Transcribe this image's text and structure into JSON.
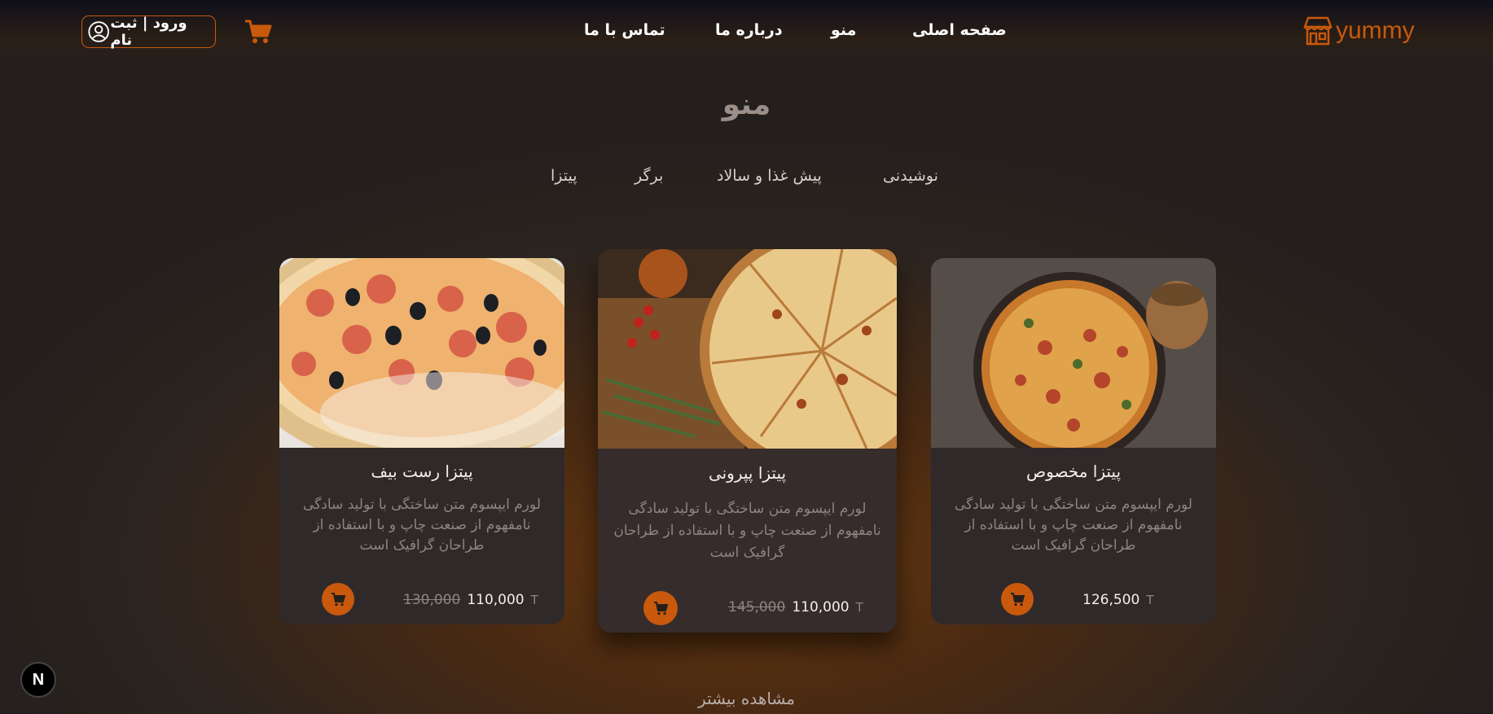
{
  "brand": {
    "name": "yummy",
    "accent": "#c9590c"
  },
  "nav": {
    "home": "صفحه اصلی",
    "menu": "منو",
    "about": "درباره ما",
    "contact": "تماس با ما"
  },
  "auth": {
    "label": "ورود | ثبت نام"
  },
  "section": {
    "title": "منو",
    "tabs": [
      "نوشیدنی",
      "پیش غذا و سالاد",
      "برگر",
      "پیتزا"
    ],
    "more": "مشاهده بیشتر"
  },
  "products": [
    {
      "name": "پیتزا مخصوص",
      "description": "لورم ایپسوم متن ساختگی با تولید سادگی نامفهوم از صنعت چاپ و با استفاده از طراحان گرافیک است",
      "old_price": "",
      "price": "126,500",
      "currency": "T"
    },
    {
      "name": "پیتزا پپرونی",
      "description": "لورم ایپسوم متن ساختگی با تولید سادگی نامفهوم از صنعت چاپ و با استفاده از طراحان گرافیک است",
      "old_price": "145,000",
      "price": "110,000",
      "currency": "T"
    },
    {
      "name": "پیتزا رست بیف",
      "description": "لورم ایپسوم متن ساختگی با تولید سادگی نامفهوم از صنعت چاپ و با استفاده از طراحان گرافیک است",
      "old_price": "130,000",
      "price": "110,000",
      "currency": "T"
    }
  ],
  "dev_badge": "N"
}
